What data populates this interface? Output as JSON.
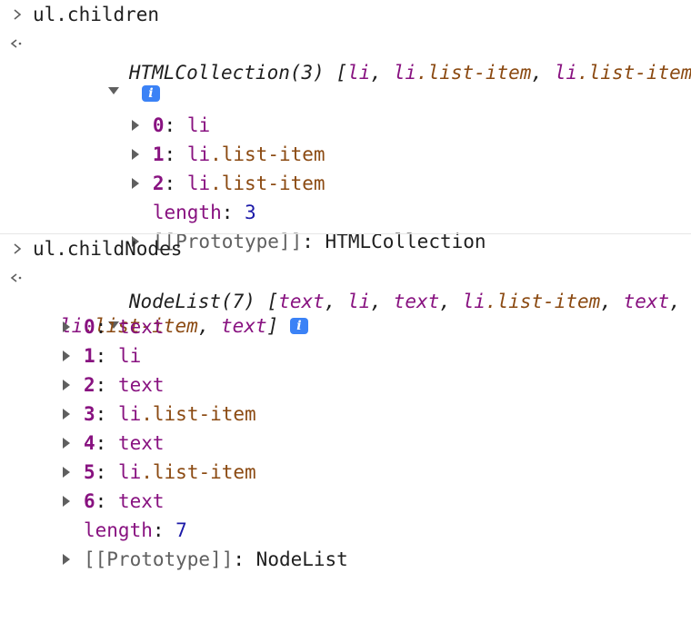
{
  "entries": [
    {
      "command": "ul.children",
      "result": {
        "type_label": "HTMLCollection(3)",
        "preview": [
          {
            "text": "li",
            "cls": ""
          },
          {
            "text": "li",
            "cls": ".list-item"
          },
          {
            "text": "li",
            "cls": ".list-item"
          }
        ],
        "info_icon": "i",
        "items": [
          {
            "index": "0",
            "tag": "li",
            "cls": ""
          },
          {
            "index": "1",
            "tag": "li",
            "cls": ".list-item"
          },
          {
            "index": "2",
            "tag": "li",
            "cls": ".list-item"
          }
        ],
        "length_key": "length",
        "length_value": "3",
        "prototype_key": "[[Prototype]]",
        "prototype_value": "HTMLCollection"
      }
    },
    {
      "command": "ul.childNodes",
      "result": {
        "type_label": "NodeList(7)",
        "preview": [
          {
            "text": "text",
            "cls": ""
          },
          {
            "text": "li",
            "cls": ""
          },
          {
            "text": "text",
            "cls": ""
          },
          {
            "text": "li",
            "cls": ".list-item"
          },
          {
            "text": "text",
            "cls": ""
          },
          {
            "text": "li",
            "cls": ".list-item"
          },
          {
            "text": "text",
            "cls": ""
          }
        ],
        "info_icon": "i",
        "items": [
          {
            "index": "0",
            "tag": "text",
            "cls": ""
          },
          {
            "index": "1",
            "tag": "li",
            "cls": ""
          },
          {
            "index": "2",
            "tag": "text",
            "cls": ""
          },
          {
            "index": "3",
            "tag": "li",
            "cls": ".list-item"
          },
          {
            "index": "4",
            "tag": "text",
            "cls": ""
          },
          {
            "index": "5",
            "tag": "li",
            "cls": ".list-item"
          },
          {
            "index": "6",
            "tag": "text",
            "cls": ""
          }
        ],
        "length_key": "length",
        "length_value": "7",
        "prototype_key": "[[Prototype]]",
        "prototype_value": "NodeList"
      }
    }
  ],
  "icons": {
    "prompt": "chevron-right-icon",
    "result": "return-arrow-icon",
    "expanded": "triangle-down-icon",
    "collapsed": "triangle-right-icon"
  },
  "colors": {
    "tag": "#881280",
    "class": "#8b4a12",
    "number": "#1c1aa8",
    "info_badge": "#3b82f6"
  }
}
